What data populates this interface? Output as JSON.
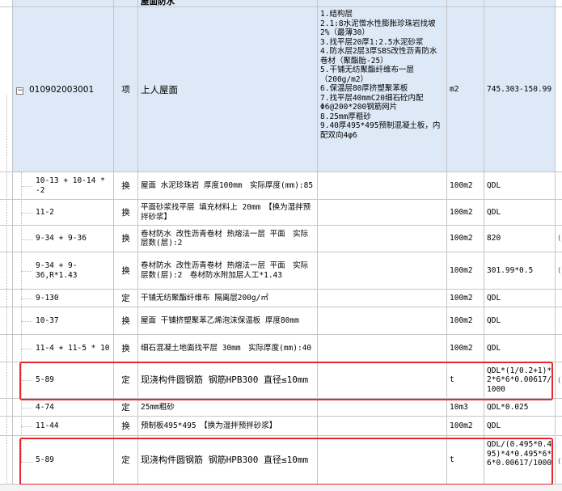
{
  "section": {
    "name": "屋面防水"
  },
  "parent": {
    "code": "010902003001",
    "type": "项",
    "name": "上人屋面",
    "features": [
      "1.结构层",
      "2.1:8水泥憎水性膨胀珍珠岩找坡2%（最薄30）",
      "3.找平层20厚1:2.5水泥砂浆",
      "4.防水层2层3厚SBS改性沥青防水卷材（聚酯胎-25）",
      "5.干铺无纺聚酯纤维布一层（200g/m2）",
      "6.保温层80厚挤塑聚苯板",
      "7.找平层40mmC20细石砼内配Φ6@200*200钢筋网片",
      "8.25mm厚粗砂",
      "9.40厚495*495预制混凝土板，内配双向4φ6"
    ],
    "unit": "m2",
    "quantity_expr": "745.303-150.99"
  },
  "rows": [
    {
      "code": "10-13 + 10-14 * -2",
      "type": "换",
      "name": "屋面 水泥珍珠岩 厚度100mm　实际厚度(mm):85",
      "unit": "100m2",
      "qty": "QDL"
    },
    {
      "code": "11-2",
      "type": "换",
      "name": "平面砂浆找平层 填充材料上 20mm　【换为湿拌预拌砂浆】",
      "unit": "100m2",
      "qty": "QDL"
    },
    {
      "code": "9-34 + 9-36",
      "type": "换",
      "name": "卷材防水 改性沥青卷材 热熔法一层 平面　实际层数(层):2",
      "unit": "100m2",
      "qty": "820"
    },
    {
      "code": "9-34 + 9-36,R*1.43",
      "type": "换",
      "name": "卷材防水 改性沥青卷材 热熔法一层 平面　实际层数(层):2　卷材防水附加层人工*1.43",
      "unit": "100m2",
      "qty": "301.99*0.5"
    },
    {
      "code": "9-130",
      "type": "定",
      "name": "干铺无纺聚酯纤维布 隔离层200g/㎡",
      "unit": "100m2",
      "qty": "QDL"
    },
    {
      "code": "10-37",
      "type": "换",
      "name": "屋面 干铺挤塑聚苯乙烯泡沫保温板 厚度80mm",
      "unit": "100m2",
      "qty": "QDL"
    },
    {
      "code": "11-4 + 11-5 * 10",
      "type": "换",
      "name": "细石混凝土地面找平层 30mm　实际厚度(mm):40",
      "unit": "100m2",
      "qty": "QDL"
    },
    {
      "code": "5-89",
      "type": "定",
      "name": "现浇构件圆钢筋 钢筋HPB300 直径≤10mm",
      "unit": "t",
      "qty": "QDL*(1/0.2+1)*2*6*6*0.00617/1000"
    },
    {
      "code": "4-74",
      "type": "定",
      "name": "25mm粗砂",
      "unit": "10m3",
      "qty": "QDL*0.025"
    },
    {
      "code": "11-44",
      "type": "换",
      "name": "预制板495*495　【换为湿拌预拌砂浆】",
      "unit": "100m2",
      "qty": "QDL"
    },
    {
      "code": "5-89",
      "type": "定",
      "name": "现浇构件圆钢筋 钢筋HPB300 直径≤10mm",
      "unit": "t",
      "qty": "QDL/(0.495*0.495)*4*0.495*6*6*0.00617/1000"
    }
  ],
  "expander_symbol": "−",
  "edge_marks": [
    "(",
    "(",
    "(",
    "("
  ],
  "colors": {
    "highlight": "#e8282c",
    "selected_bg": "#dde9f7",
    "grid_line": "#c5c5c5"
  }
}
